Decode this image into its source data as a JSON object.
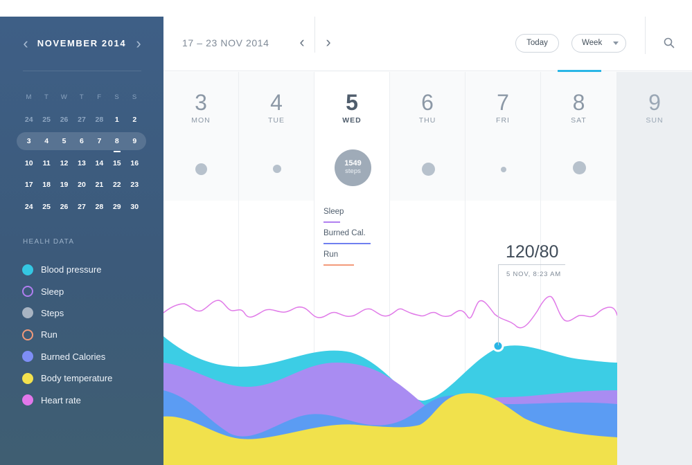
{
  "sidebar": {
    "month_title": "NOVEMBER 2014",
    "weekday_headers": [
      "M",
      "T",
      "W",
      "T",
      "F",
      "S",
      "S"
    ],
    "weeks": [
      {
        "days": [
          "24",
          "25",
          "26",
          "27",
          "28",
          "1",
          "2"
        ],
        "muted": [
          true,
          true,
          true,
          true,
          true,
          false,
          false
        ],
        "selected": false
      },
      {
        "days": [
          "3",
          "4",
          "5",
          "6",
          "7",
          "8",
          "9"
        ],
        "muted": [
          false,
          false,
          false,
          false,
          false,
          false,
          false
        ],
        "selected": true
      },
      {
        "days": [
          "10",
          "11",
          "12",
          "13",
          "14",
          "15",
          "16"
        ],
        "muted": [
          false,
          false,
          false,
          false,
          false,
          false,
          false
        ],
        "selected": false
      },
      {
        "days": [
          "17",
          "18",
          "19",
          "20",
          "21",
          "22",
          "23"
        ],
        "muted": [
          false,
          false,
          false,
          false,
          false,
          false,
          false
        ],
        "selected": false
      },
      {
        "days": [
          "24",
          "25",
          "26",
          "27",
          "28",
          "29",
          "30"
        ],
        "muted": [
          false,
          false,
          false,
          false,
          false,
          false,
          false
        ],
        "selected": false
      }
    ],
    "today": "8",
    "health_title": "HEALH DATA",
    "health_items": [
      {
        "label": "Blood pressure",
        "color": "#34c7e3",
        "style": "filled",
        "icon": "blood-pressure-dot-icon"
      },
      {
        "label": "Sleep",
        "color": "#b07ef0",
        "style": "ring",
        "icon": "sleep-ring-icon"
      },
      {
        "label": "Steps",
        "color": "#a8b4c2",
        "style": "filled",
        "icon": "steps-dot-icon"
      },
      {
        "label": "Run",
        "color": "#f39a7a",
        "style": "ring",
        "icon": "run-ring-icon"
      },
      {
        "label": "Burned Calories",
        "color": "#7e8ef5",
        "style": "filled",
        "icon": "burned-calories-dot-icon"
      },
      {
        "label": "Body temperature",
        "color": "#f4e24e",
        "style": "filled",
        "icon": "body-temperature-dot-icon"
      },
      {
        "label": "Heart rate",
        "color": "#e277ea",
        "style": "filled",
        "icon": "heart-rate-dot-icon"
      }
    ]
  },
  "header": {
    "date_range": "17 – 23 NOV 2014",
    "today_label": "Today",
    "week_label": "Week"
  },
  "days": [
    {
      "num": "3",
      "dow": "MON",
      "active": false,
      "off": false
    },
    {
      "num": "4",
      "dow": "TUE",
      "active": false,
      "off": false
    },
    {
      "num": "5",
      "dow": "WED",
      "active": true,
      "off": false
    },
    {
      "num": "6",
      "dow": "THU",
      "active": false,
      "off": false
    },
    {
      "num": "7",
      "dow": "FRI",
      "active": false,
      "off": false
    },
    {
      "num": "8",
      "dow": "SAT",
      "active": false,
      "off": false
    },
    {
      "num": "9",
      "dow": "SUN",
      "active": false,
      "off": true
    }
  ],
  "steps_bubble": {
    "value": "1549",
    "unit": "steps"
  },
  "mini_legend": [
    {
      "label": "Sleep",
      "color": "#b07ef0"
    },
    {
      "label": "Burned Cal.",
      "color": "#6f7ff0"
    },
    {
      "label": "Run",
      "color": "#f39a7a"
    }
  ],
  "tooltip": {
    "value": "120/80",
    "timestamp": "5 NOV, 8:23 AM"
  },
  "colors": {
    "accent": "#2ab6e6",
    "blood_pressure": "#3ccde5",
    "sleep_area": "#a98cf2",
    "burned_calories": "#5b9cf3",
    "body_temperature": "#f1e14c",
    "heart_rate_line": "#e07ae8"
  }
}
